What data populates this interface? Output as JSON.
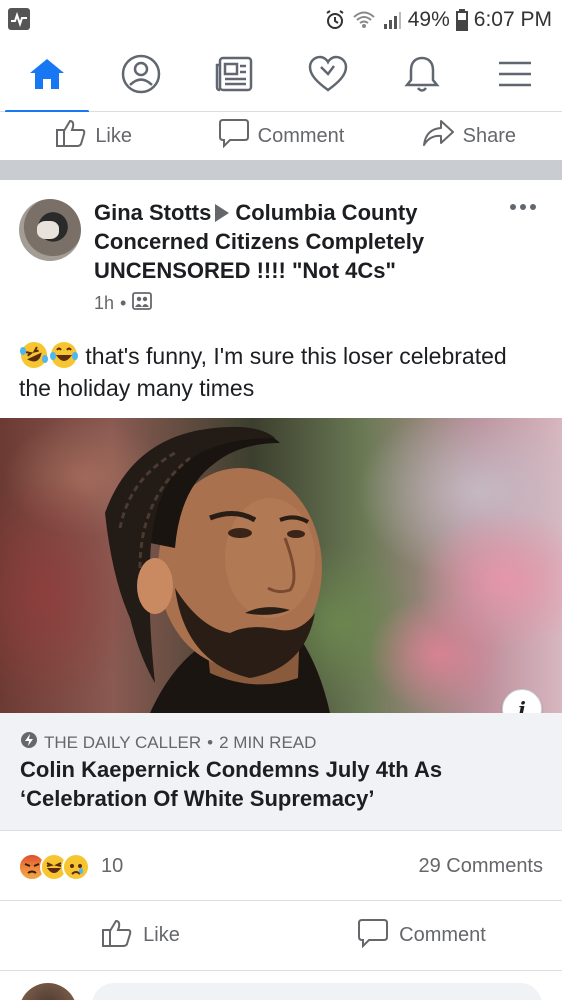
{
  "status_bar": {
    "battery": "49%",
    "time": "6:07 PM"
  },
  "nav": {
    "items": [
      {
        "name": "home",
        "icon": "home-icon",
        "active": true
      },
      {
        "name": "profile",
        "icon": "profile-icon",
        "active": false
      },
      {
        "name": "news",
        "icon": "newspaper-icon",
        "active": false
      },
      {
        "name": "dating",
        "icon": "heart-icon",
        "active": false
      },
      {
        "name": "notifications",
        "icon": "bell-icon",
        "active": false
      },
      {
        "name": "menu",
        "icon": "hamburger-icon",
        "active": false
      }
    ],
    "accent_color": "#1877f2"
  },
  "prev_post_actions": {
    "like": "Like",
    "comment": "Comment",
    "share": "Share"
  },
  "post": {
    "author": "Gina Stotts",
    "group": "Columbia County Concerned Citizens Completely UNCENSORED !!!! \"Not 4Cs\"",
    "time": "1h",
    "text": "that's funny, I'm sure this loser celebrated the holiday many times",
    "link": {
      "source": "THE DAILY CALLER",
      "read_time": "2 MIN READ",
      "title": "Colin Kaepernick Condemns July 4th As ‘Celebration Of White Supremacy’"
    },
    "reaction_count": "10",
    "comments_count": "29 Comments",
    "actions": {
      "like": "Like",
      "comment": "Comment"
    }
  }
}
